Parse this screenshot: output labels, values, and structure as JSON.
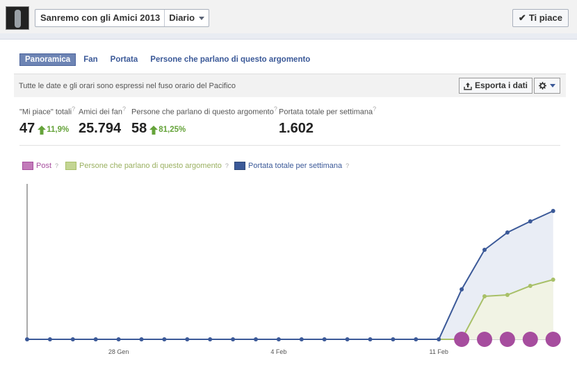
{
  "header": {
    "page_name": "Sanremo con gli Amici 2013",
    "view_label": "Diario",
    "like_button": "Ti piace"
  },
  "tabs": [
    {
      "label": "Panoramica",
      "active": true
    },
    {
      "label": "Fan",
      "active": false
    },
    {
      "label": "Portata",
      "active": false
    },
    {
      "label": "Persone che parlano di questo argomento",
      "active": false
    }
  ],
  "notice": {
    "text": "Tutte le date e gli orari sono espressi nel fuso orario del Pacifico",
    "export_label": "Esporta i dati",
    "export_icon": "export-icon",
    "settings_icon": "gear-icon"
  },
  "stats": [
    {
      "label": "\"Mi piace\" totali",
      "value": "47",
      "change": "11,9%"
    },
    {
      "label": "Amici dei fan",
      "value": "25.794",
      "change": ""
    },
    {
      "label": "Persone che parlano di questo argomento",
      "value": "58",
      "change": "81,25%"
    },
    {
      "label": "Portata totale per settimana",
      "value": "1.602",
      "change": ""
    }
  ],
  "help_mark": "?",
  "colors": {
    "post": "#a64d9e",
    "talking": "#a8c068",
    "reach": "#3b5998",
    "positive": "#65a33a"
  },
  "chart_data": {
    "type": "line",
    "x_tick_labels": [
      "28 Gen",
      "4 Feb",
      "11 Feb"
    ],
    "x_tick_index": [
      4,
      11,
      18
    ],
    "point_count": 24,
    "series": [
      {
        "name": "Post",
        "type": "bubble",
        "points_index": [
          19,
          20,
          21,
          22,
          23
        ]
      },
      {
        "name": "Persone che parlano di questo argomento",
        "values": [
          0,
          0,
          0,
          0,
          0,
          0,
          0,
          0,
          0,
          0,
          0,
          0,
          0,
          0,
          0,
          0,
          0,
          0,
          0,
          0,
          62,
          64,
          77,
          86
        ]
      },
      {
        "name": "Portata totale per settimana",
        "values": [
          0,
          0,
          0,
          0,
          0,
          0,
          0,
          0,
          0,
          0,
          0,
          0,
          0,
          0,
          0,
          0,
          0,
          0,
          0,
          72,
          129,
          154,
          170,
          185
        ]
      }
    ],
    "grid": false,
    "legend_position": "top-left"
  }
}
